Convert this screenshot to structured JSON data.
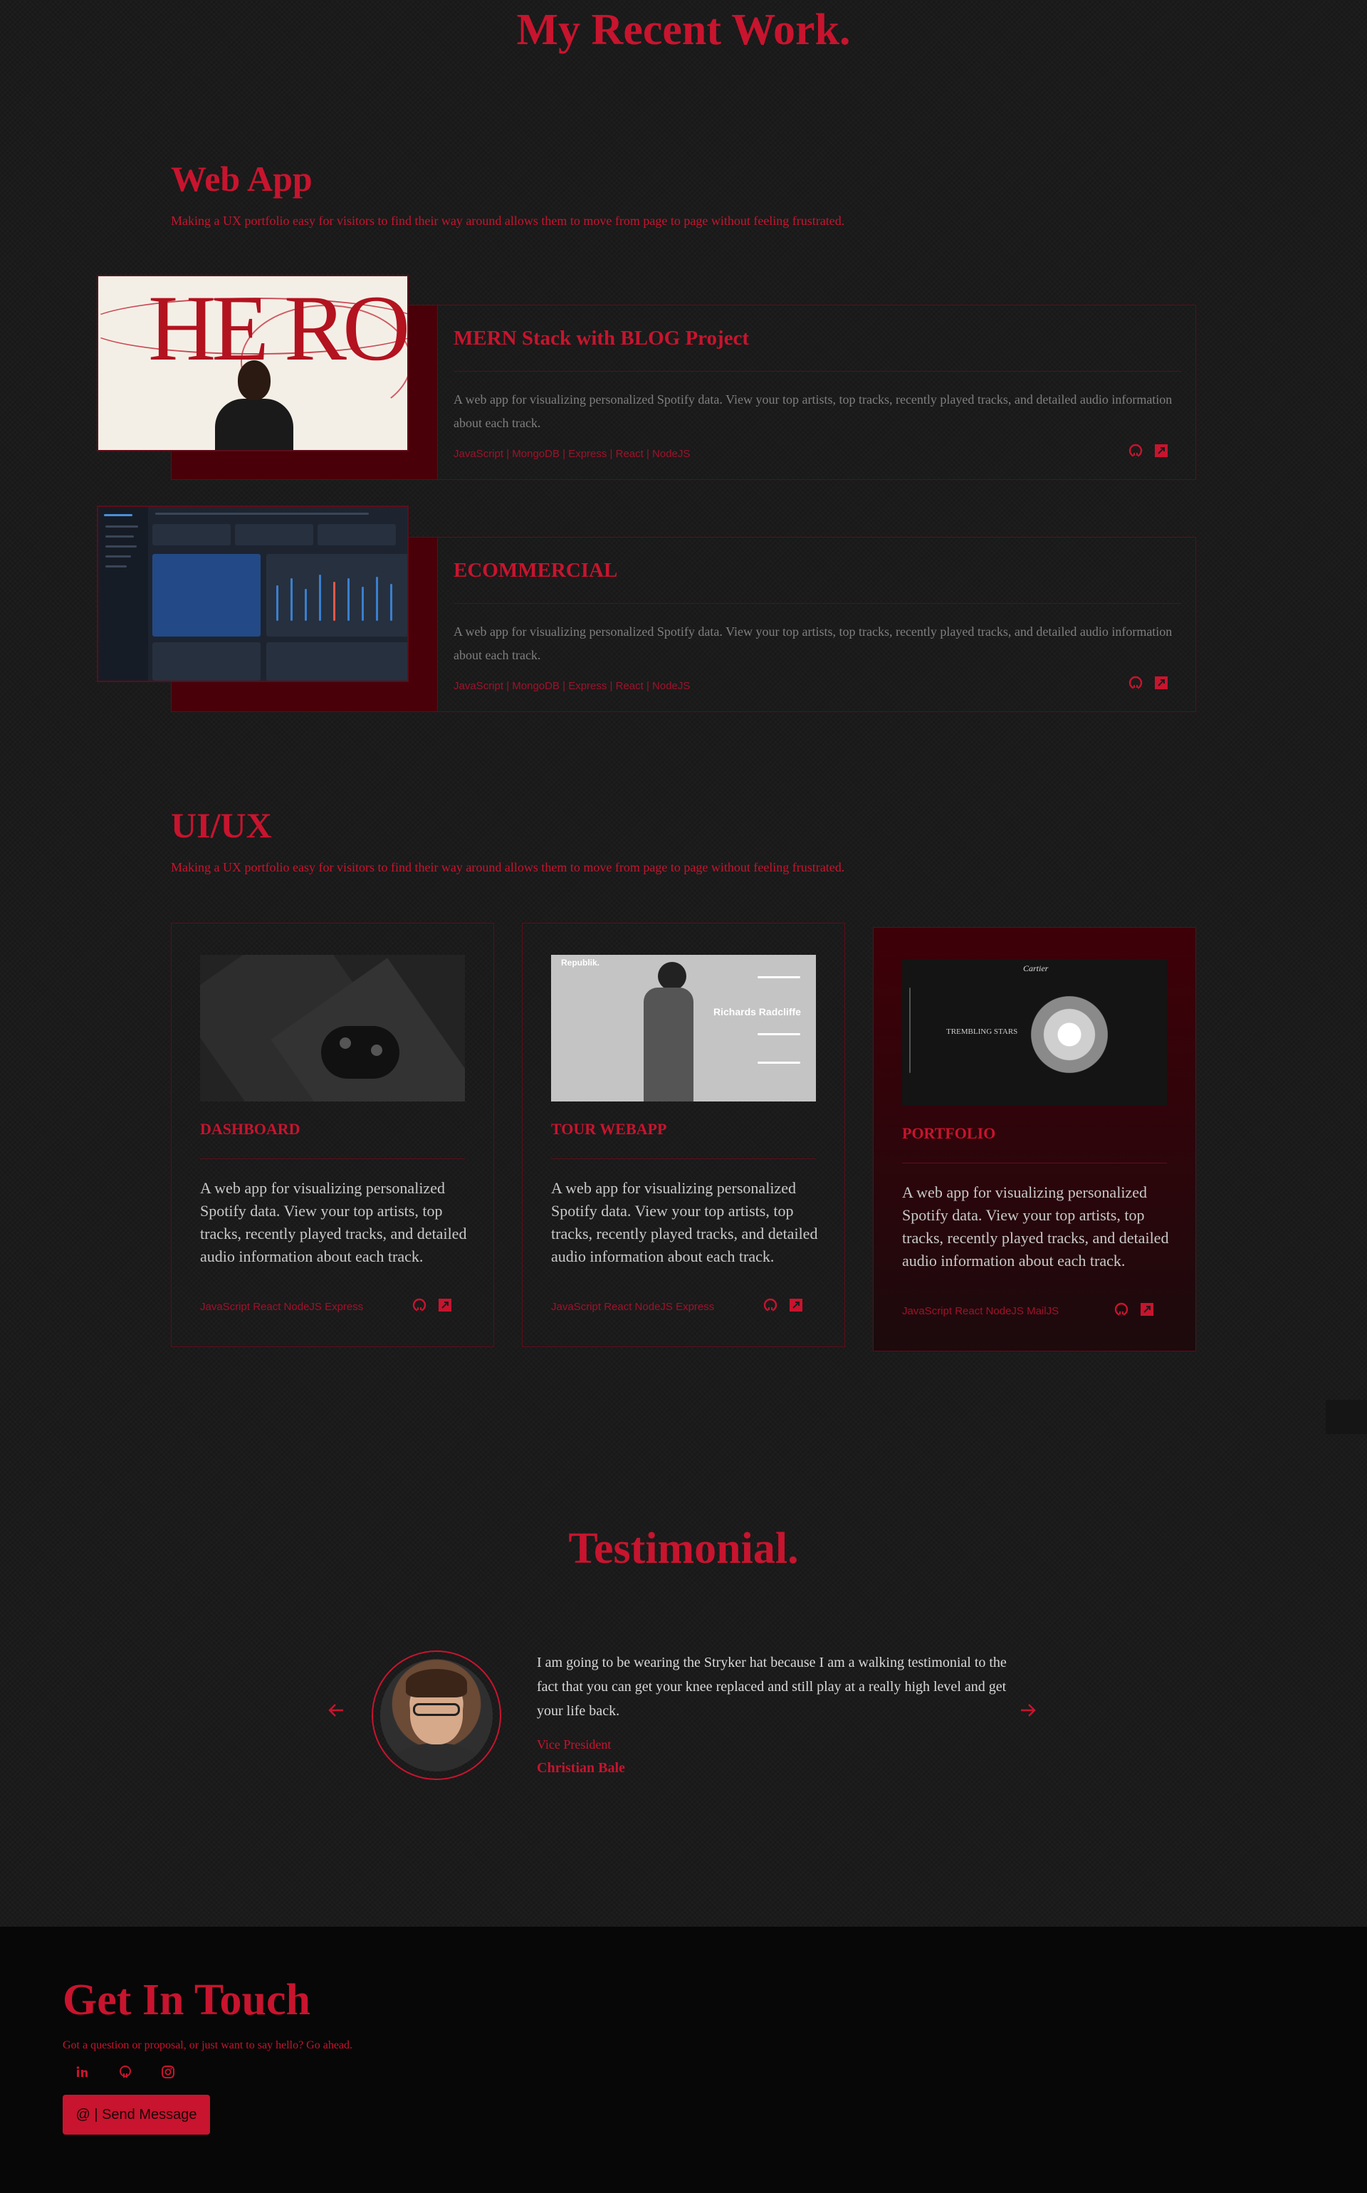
{
  "page_title": "My Recent Work.",
  "web_app": {
    "title": "Web App",
    "subtitle": "Making a UX portfolio easy for visitors to find their way around allows them to move from page to page without feeling frustrated.",
    "projects": [
      {
        "title": "MERN Stack with BLOG Project",
        "description": "A web app for visualizing personalized Spotify data. View your top artists, top tracks, recently played tracks, and detailed audio information about each track.",
        "tech": "JavaScript | MongoDB | Express | React | NodeJS",
        "thumb_text": "HE RO"
      },
      {
        "title": "ECOMMERCIAL",
        "description": "A web app for visualizing personalized Spotify data. View your top artists, top tracks, recently played tracks, and detailed audio information about each track.",
        "tech": "JavaScript | MongoDB | Express | React | NodeJS"
      }
    ]
  },
  "ui_ux": {
    "title": "UI/UX",
    "subtitle": "Making a UX portfolio easy for visitors to find their way around allows them to move from page to page without feeling frustrated.",
    "projects": [
      {
        "title": "DASHBOARD",
        "description": "A web app for visualizing personalized Spotify data. View your top artists, top tracks, recently played tracks, and detailed audio information about each track.",
        "tech": "JavaScript React NodeJS Express"
      },
      {
        "title": "TOUR WEBAPP",
        "description": "A web app for visualizing personalized Spotify data. View your top artists, top tracks, recently played tracks, and detailed audio information about each track.",
        "tech": "JavaScript React NodeJS Express",
        "thumb_brand": "Republik.",
        "thumb_name": "Richards Radcliffe"
      },
      {
        "title": "PORTFOLIO",
        "description": "A web app for visualizing personalized Spotify data. View your top artists, top tracks, recently played tracks, and detailed audio information about each track.",
        "tech": "JavaScript React NodeJS MailJS",
        "thumb_brand": "Cartier",
        "thumb_overlay": "TREMBLING STARS"
      }
    ]
  },
  "testimonial": {
    "title": "Testimonial.",
    "quote": "I am going to be wearing the Stryker hat because I am a walking testimonial to the fact that you can get your knee replaced and still play at a really high level and get your life back.",
    "role": "Vice President",
    "name": "Christian Bale"
  },
  "contact": {
    "title": "Get In Touch",
    "subtitle": "Got a question or proposal, or just want to say hello? Go ahead.",
    "button_label": "@ | Send Message"
  },
  "icons": {
    "github": "github-icon",
    "external": "external-link-icon",
    "linkedin": "linkedin-icon",
    "instagram": "instagram-icon",
    "arrow_left": "arrow-left-icon",
    "arrow_right": "arrow-right-icon"
  },
  "colors": {
    "accent": "#c8142e",
    "background": "#1b1b1b",
    "footer": "#070707"
  }
}
